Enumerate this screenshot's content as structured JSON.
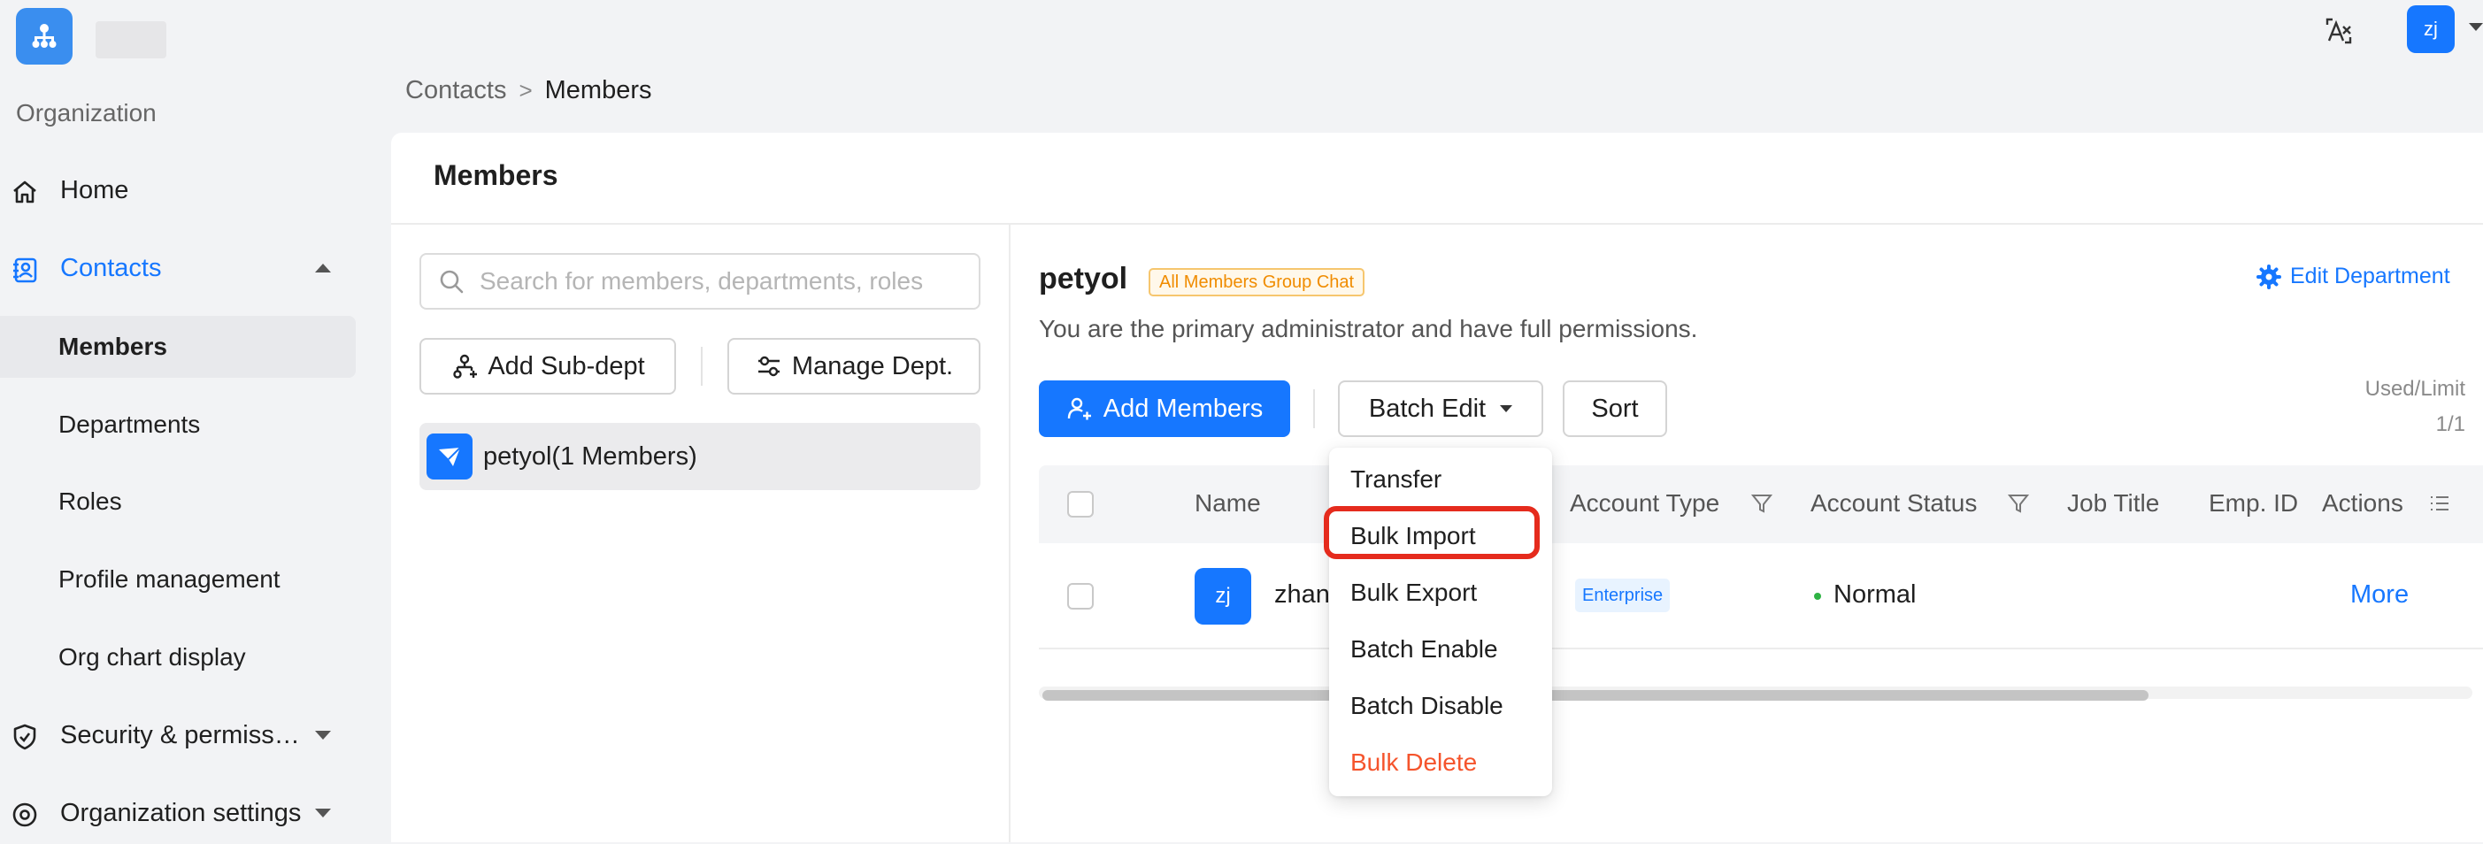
{
  "app": {
    "org_label": "Organization"
  },
  "header": {
    "avatar_initials": "zj"
  },
  "sidebar": {
    "home": "Home",
    "contacts": "Contacts",
    "contacts_sub": {
      "members": "Members",
      "departments": "Departments",
      "roles": "Roles",
      "profile_management": "Profile management",
      "org_chart_display": "Org chart display"
    },
    "security": "Security & permiss…",
    "org_settings": "Organization settings"
  },
  "breadcrumb": {
    "parent": "Contacts",
    "separator": ">",
    "current": "Members"
  },
  "page": {
    "title": "Members"
  },
  "dept_panel": {
    "search_placeholder": "Search for members, departments, roles",
    "add_subdept": "Add Sub-dept",
    "manage_dept": "Manage Dept.",
    "dept_item": "petyol(1 Members)"
  },
  "detail": {
    "dept_name": "petyol",
    "group_chat_tag": "All Members Group Chat",
    "edit_department": "Edit Department",
    "admin_note": "You are the primary administrator and have full permissions.",
    "add_members": "Add Members",
    "batch_edit": "Batch Edit",
    "sort": "Sort",
    "usage_label": "Used/Limit",
    "usage_value": "1/1"
  },
  "table": {
    "columns": [
      "Name",
      "Account Type",
      "Account Status",
      "Job Title",
      "Emp. ID",
      "Actions"
    ],
    "rows": [
      {
        "avatar": "zj",
        "name": "zhan",
        "account_type": "Enterprise",
        "status": "Normal",
        "action": "More"
      }
    ]
  },
  "batch_menu": {
    "items": [
      "Transfer",
      "Bulk Import",
      "Bulk Export",
      "Batch Enable",
      "Batch Disable",
      "Bulk Delete"
    ],
    "highlighted": "Bulk Import"
  },
  "colors": {
    "accent": "#1677ff",
    "danger": "#f5542c",
    "highlight": "#e52b1d",
    "tag_orange": "#f08c00",
    "status_green": "#2fb344"
  }
}
